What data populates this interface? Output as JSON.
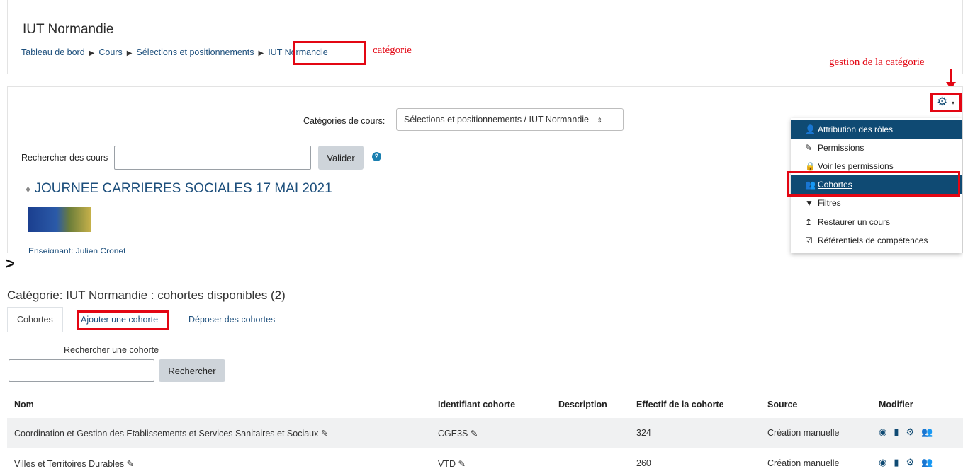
{
  "header": {
    "site_title": "IUT Normandie",
    "breadcrumb": [
      "Tableau de bord",
      "Cours",
      "Sélections et positionnements",
      "IUT Normandie"
    ],
    "separator": "▶"
  },
  "annotations": {
    "category_note": "catégorie",
    "manage_note": "gestion de la catégorie",
    "annotation_color": "#e30613",
    "gt_symbol": ">"
  },
  "category_panel": {
    "category_label": "Catégories de cours:",
    "category_value": "Sélections et positionnements / IUT Normandie",
    "search_label": "Rechercher des cours",
    "search_button": "Valider",
    "course_title": "JOURNEE CARRIERES SOCIALES 17 MAI 2021",
    "teacher_partial": "Enseignant: Julien Cronet"
  },
  "gear_menu": {
    "items": [
      {
        "icon": "user-plus-icon",
        "glyph": "👤",
        "label": "Attribution des rôles"
      },
      {
        "icon": "edit-icon",
        "glyph": "✎",
        "label": "Permissions"
      },
      {
        "icon": "lock-icon",
        "glyph": "🔒",
        "label": "Voir les permissions"
      },
      {
        "icon": "users-icon",
        "glyph": "👥",
        "label": "Cohortes"
      },
      {
        "icon": "filter-icon",
        "glyph": "▼",
        "label": "Filtres"
      },
      {
        "icon": "restore-icon",
        "glyph": "↥",
        "label": "Restaurer un cours"
      },
      {
        "icon": "checkbox-icon",
        "glyph": "☑",
        "label": "Référentiels de compétences"
      }
    ]
  },
  "cohorts_page": {
    "heading": "Catégorie: IUT Normandie : cohortes disponibles (2)",
    "tabs": [
      "Cohortes",
      "Ajouter une cohorte",
      "Déposer des cohortes"
    ],
    "search_label": "Rechercher une cohorte",
    "search_button": "Rechercher",
    "columns": [
      "Nom",
      "Identifiant cohorte",
      "Description",
      "Effectif de la cohorte",
      "Source",
      "Modifier"
    ],
    "rows": [
      {
        "name": "Coordination et Gestion des Etablissements et Services Sanitaires et Sociaux",
        "id": "CGE3S",
        "description": "",
        "count": "324",
        "source": "Création manuelle"
      },
      {
        "name": "Villes et Territoires Durables",
        "id": "VTD",
        "description": "",
        "count": "260",
        "source": "Création manuelle"
      }
    ]
  }
}
